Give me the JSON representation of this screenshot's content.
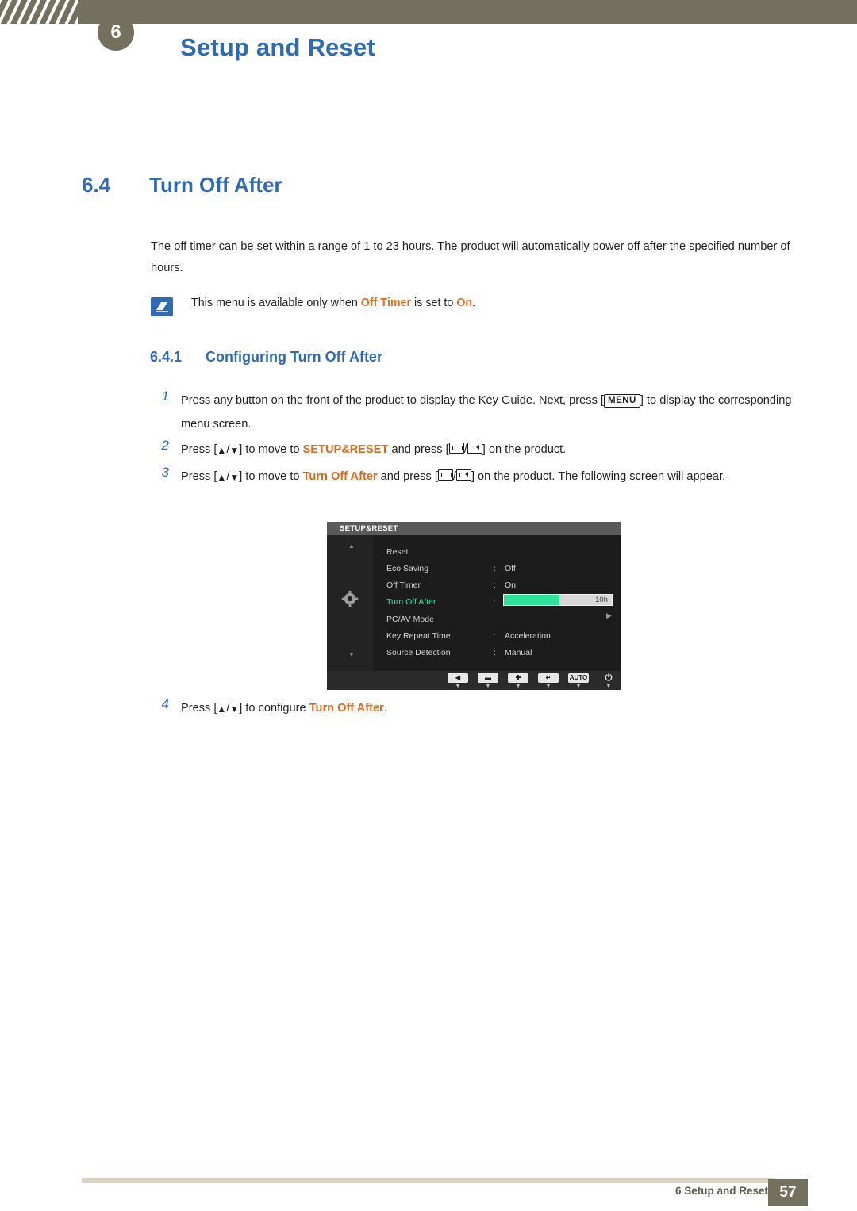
{
  "header": {
    "chapter_number": "6",
    "title": "Setup and Reset"
  },
  "section": {
    "number": "6.4",
    "title": "Turn Off After"
  },
  "intro_paragraph": "The off timer can be set within a range of 1 to 23 hours. The product will automatically power off after the specified number of hours.",
  "note": {
    "icon": "note-icon",
    "text_before": "This menu is available only when ",
    "highlight_1": "Off Timer",
    "text_middle": " is set to ",
    "highlight_2": "On",
    "text_after": "."
  },
  "subsection": {
    "number": "6.4.1",
    "title": "Configuring Turn Off After"
  },
  "steps": [
    {
      "number": "1",
      "text_a": "Press any button on the front of the product to display the Key Guide. Next, press [",
      "key": "MENU",
      "text_b": "] to display the corresponding menu screen."
    },
    {
      "number": "2",
      "text_a": "Press [",
      "text_b": "] to move to ",
      "highlight": "SETUP&RESET",
      "text_c": " and press [",
      "text_d": "] on the product."
    },
    {
      "number": "3",
      "text_a": "Press [",
      "text_b": "] to move to ",
      "highlight": "Turn Off After",
      "text_c": " and press [",
      "text_d": "] on the product. The following screen will appear."
    },
    {
      "number": "4",
      "text_a": "Press [",
      "text_b": "] to configure ",
      "highlight": "Turn Off After",
      "text_c": "."
    }
  ],
  "osd": {
    "title": "SETUP&RESET",
    "rows": [
      {
        "label": "Reset",
        "colon": "",
        "value": ""
      },
      {
        "label": "Eco Saving",
        "colon": ":",
        "value": "Off"
      },
      {
        "label": "Off Timer",
        "colon": ":",
        "value": "On"
      },
      {
        "label": "Turn Off After",
        "colon": ":",
        "value": ""
      },
      {
        "label": "PC/AV Mode",
        "colon": "",
        "value": ""
      },
      {
        "label": "Key Repeat Time",
        "colon": ":",
        "value": "Acceleration"
      },
      {
        "label": "Source Detection",
        "colon": ":",
        "value": "Manual"
      }
    ],
    "slider_value": "10h",
    "buttons": [
      {
        "label": "◀",
        "sub": "▼"
      },
      {
        "label": "▬",
        "sub": "▼"
      },
      {
        "label": "✚",
        "sub": "▼"
      },
      {
        "label": "↵",
        "sub": "▼"
      },
      {
        "label": "AUTO",
        "sub": "▼"
      },
      {
        "label": "⏻",
        "sub": "▼"
      }
    ]
  },
  "footer": {
    "text": "6 Setup and Reset",
    "page": "57"
  },
  "colors": {
    "accent_blue": "#2f6ab4",
    "accent_orange": "#e06a1b",
    "header_olive": "#73705d",
    "osd_green": "#2fe39a"
  }
}
